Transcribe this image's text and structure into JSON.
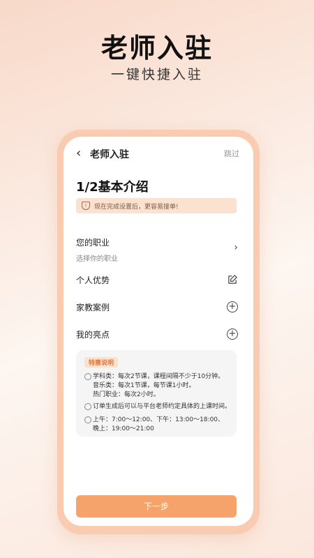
{
  "hero": {
    "title": "老师入驻",
    "subtitle": "一键快捷入驻"
  },
  "nav": {
    "back_icon": "chevron-left-icon",
    "title": "老师入驻",
    "skip_label": "跳过"
  },
  "step": {
    "title": "1/2基本介绍"
  },
  "notice": {
    "icon": "shield-icon",
    "text": "现在完成设置后，更容易接单!"
  },
  "form": {
    "occupation": {
      "label": "您的职业",
      "placeholder": "选择你的职业",
      "icon": "chevron-right-icon"
    },
    "advantages": {
      "label": "个人优势",
      "icon": "edit-icon"
    },
    "cases": {
      "label": "家教案例",
      "icon": "add-circle-icon"
    },
    "highlights": {
      "label": "我的亮点",
      "icon": "add-circle-icon"
    }
  },
  "tips": {
    "tag": "特惠说明",
    "items": [
      {
        "lines": [
          "学科类：每次2节课，课程间隔不少于10分钟。",
          "音乐类：每次1节课，每节课1小时。",
          "热门职业：每次2小时。"
        ]
      },
      {
        "lines": [
          "订单生成后可以与平台老师约定具体的上课时间。"
        ]
      },
      {
        "lines": [
          "上午：7:00～12:00、下午：13:00～18:00、",
          "晚上：19:00～21:00"
        ]
      }
    ]
  },
  "next_button": {
    "label": "下一步"
  },
  "colors": {
    "accent": "#f5a26b",
    "notice_bg": "#fbe1cf",
    "frame": "#f9cbb0"
  }
}
